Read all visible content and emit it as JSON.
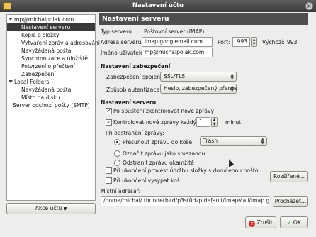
{
  "window": {
    "title": "Nastavení účtu"
  },
  "tree": {
    "items": [
      {
        "label": "mp@michalpolak.com"
      },
      {
        "label": "Nastavení serveru"
      },
      {
        "label": "Kopie a složky"
      },
      {
        "label": "Vytváření zpráv a adresování"
      },
      {
        "label": "Nevyžádaná pošta"
      },
      {
        "label": "Synchronizace a úložiště"
      },
      {
        "label": "Potvrzení o přečtení"
      },
      {
        "label": "Zabezpečení"
      },
      {
        "label": "Local Folders"
      },
      {
        "label": "Nevyžádaná pošta"
      },
      {
        "label": "Místo na disku"
      },
      {
        "label": "Server odchozí pošty (SMTP)"
      }
    ]
  },
  "account_actions_label": "Akce účtu",
  "panel": {
    "title": "Nastavení serveru",
    "server_type_label": "Typ serveru:",
    "server_type_value": "Poštovní server (IMAP)",
    "server_address_label": "Adresa serveru:",
    "server_address_value": "imap.googlemail.com",
    "port_label": "Port:",
    "port_value": "993",
    "default_label": "Výchozí:",
    "default_value": "993",
    "username_label": "Jméno uživatele:",
    "username_value": "mp@michalpolak.com",
    "security_section": "Nastavení zabezpečení",
    "connection_security_label": "Zabezpečení spojení:",
    "connection_security_value": "SSL/TLS",
    "auth_method_label": "Způsob autentizace:",
    "auth_method_value": "Heslo, zabezpečený přenos",
    "server_section": "Nastavení serveru",
    "check_on_startup_label": "Po spuštění zkontrolovat nové zprávy",
    "check_on_startup_checked": true,
    "check_every_label": "Kontrolovat nové zprávy každých",
    "check_every_checked": true,
    "check_every_value": "1",
    "minutes_label": "minut",
    "on_delete_label": "Při odstranění zprávy:",
    "move_to_label": "Přesunout zprávu do koše",
    "move_to_selected": true,
    "trash_value": "Trash",
    "mark_deleted_label": "Označit zprávu jako smazanou",
    "remove_immediately_label": "Odstranit zprávu okamžitě",
    "cleanup_on_exit_label": "Při ukončení provést údržbu složky s doručenou poštou",
    "empty_trash_label": "Při ukončení vysypat koš",
    "advanced_button": "Rozšířené...",
    "local_dir_label": "Místní adresář:",
    "local_dir_value": "/home/michal/.thunderbird/p3st0dzp.default/ImapMail/imap.googlem...",
    "browse_button": "Procházet..."
  },
  "buttons": {
    "cancel": "Zrušit",
    "ok": "OK"
  }
}
